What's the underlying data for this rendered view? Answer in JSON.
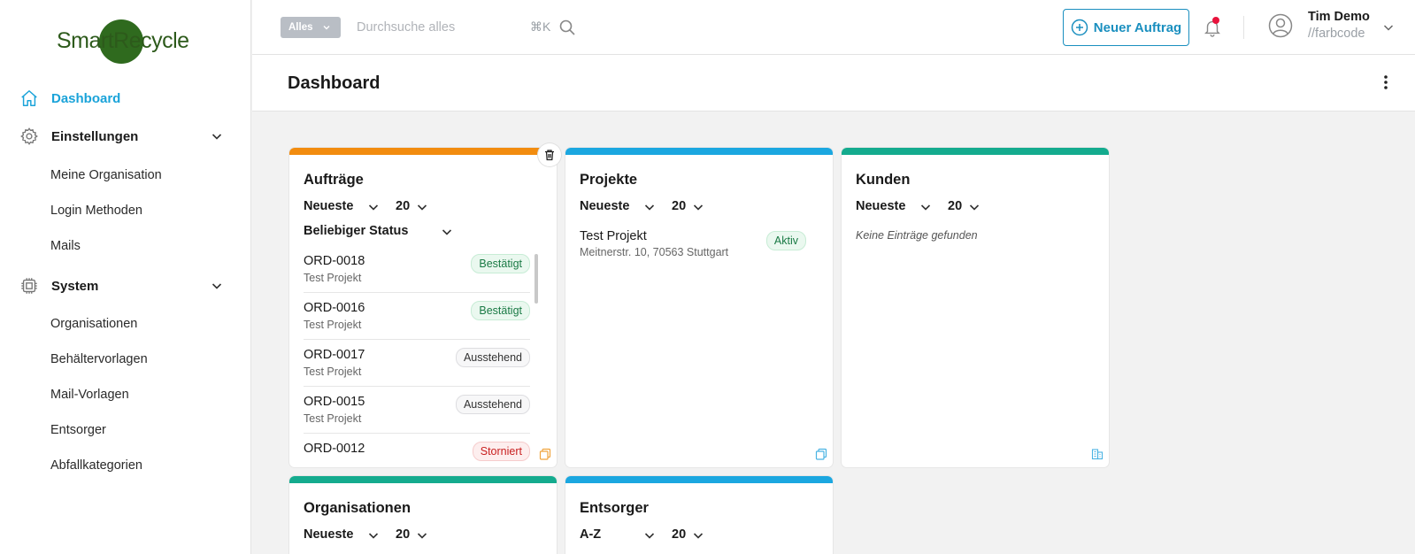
{
  "app": {
    "logo_text": "SmartRecycle"
  },
  "sidebar": {
    "items": [
      {
        "label": "Dashboard",
        "icon": "home-icon"
      },
      {
        "label": "Einstellungen",
        "icon": "gear-icon",
        "children": [
          "Meine Organisation",
          "Login Methoden",
          "Mails"
        ]
      },
      {
        "label": "System",
        "icon": "chip-icon",
        "children": [
          "Organisationen",
          "Behältervorlagen",
          "Mail-Vorlagen",
          "Entsorger",
          "Abfallkategorien"
        ]
      }
    ]
  },
  "header": {
    "search_scope": "Alles",
    "search_placeholder": "Durchsuche alles",
    "shortcut": "⌘K",
    "new_order_label": "Neuer Auftrag",
    "user_name": "Tim Demo",
    "user_org": "//farbcode"
  },
  "page": {
    "title": "Dashboard"
  },
  "cards": {
    "orders": {
      "title": "Aufträge",
      "sort": "Neueste",
      "count": "20",
      "status_filter": "Beliebiger Status",
      "rows": [
        {
          "id": "ORD-0018",
          "project": "Test Projekt",
          "status": "Bestätigt"
        },
        {
          "id": "ORD-0016",
          "project": "Test Projekt",
          "status": "Bestätigt"
        },
        {
          "id": "ORD-0017",
          "project": "Test Projekt",
          "status": "Ausstehend"
        },
        {
          "id": "ORD-0015",
          "project": "Test Projekt",
          "status": "Ausstehend"
        },
        {
          "id": "ORD-0012",
          "project": "",
          "status": "Storniert"
        }
      ]
    },
    "projects": {
      "title": "Projekte",
      "sort": "Neueste",
      "count": "20",
      "rows": [
        {
          "name": "Test Projekt",
          "address": "Meitnerstr. 10, 70563 Stuttgart",
          "status": "Aktiv"
        }
      ]
    },
    "customers": {
      "title": "Kunden",
      "sort": "Neueste",
      "count": "20",
      "empty_text": "Keine Einträge gefunden"
    },
    "organizations": {
      "title": "Organisationen",
      "sort": "Neueste",
      "count": "20"
    },
    "disposers": {
      "title": "Entsorger",
      "sort": "A-Z",
      "count": "20"
    }
  },
  "colors": {
    "accent": "#1aa3d9",
    "orders_bar": "#f28c0f",
    "projects_bar": "#1ba7e0",
    "customers_bar": "#14ab8e",
    "organizations_bar": "#14ab8e",
    "disposers_bar": "#1ba7e0"
  }
}
